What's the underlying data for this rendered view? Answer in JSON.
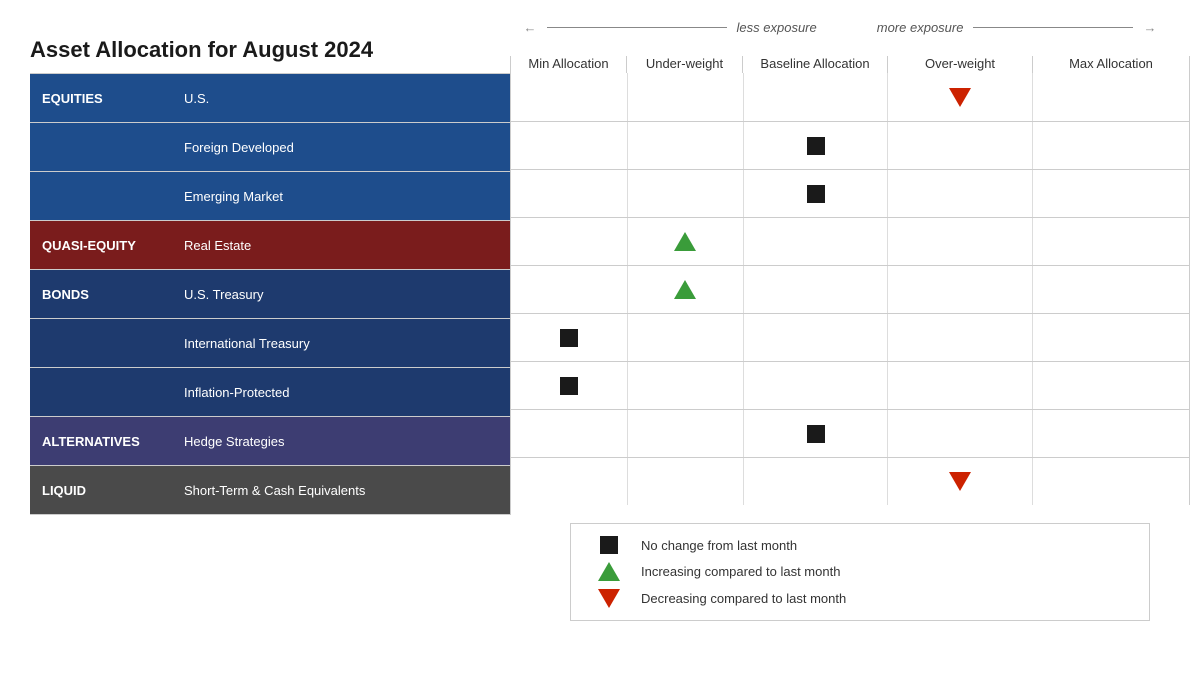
{
  "title": "Asset Allocation for August 2024",
  "exposure": {
    "less": "less exposure",
    "more": "more exposure"
  },
  "columns": {
    "min": "Min Allocation",
    "under": "Under-weight",
    "baseline": "Baseline Allocation",
    "over": "Over-weight",
    "max": "Max Allocation"
  },
  "rows": [
    {
      "category": "EQUITIES",
      "category_color": "equities-color",
      "sub_items": [
        {
          "label": "U.S.",
          "min": "",
          "under": "",
          "baseline": "",
          "over": "down",
          "max": ""
        },
        {
          "label": "Foreign Developed",
          "min": "",
          "under": "",
          "baseline": "square",
          "over": "",
          "max": ""
        },
        {
          "label": "Emerging Market",
          "min": "",
          "under": "",
          "baseline": "square",
          "over": "",
          "max": ""
        }
      ]
    },
    {
      "category": "QUASI-EQUITY",
      "category_color": "quasi-color",
      "sub_items": [
        {
          "label": "Real Estate",
          "min": "",
          "under": "up",
          "baseline": "",
          "over": "",
          "max": ""
        }
      ]
    },
    {
      "category": "BONDS",
      "category_color": "bonds-color",
      "sub_items": [
        {
          "label": "U.S. Treasury",
          "min": "",
          "under": "up",
          "baseline": "",
          "over": "",
          "max": ""
        },
        {
          "label": "International Treasury",
          "min": "square",
          "under": "",
          "baseline": "",
          "over": "",
          "max": ""
        },
        {
          "label": "Inflation-Protected",
          "min": "square",
          "under": "",
          "baseline": "",
          "over": "",
          "max": ""
        }
      ]
    },
    {
      "category": "ALTERNATIVES",
      "category_color": "alternatives-color",
      "sub_items": [
        {
          "label": "Hedge Strategies",
          "min": "",
          "under": "",
          "baseline": "square",
          "over": "",
          "max": ""
        }
      ]
    },
    {
      "category": "LIQUID",
      "category_color": "liquid-color",
      "sub_items": [
        {
          "label": "Short-Term & Cash Equivalents",
          "min": "",
          "under": "",
          "baseline": "",
          "over": "down",
          "max": ""
        }
      ]
    }
  ],
  "legend": [
    {
      "symbol": "square",
      "text": "No change from last month"
    },
    {
      "symbol": "up",
      "text": "Increasing compared to last month"
    },
    {
      "symbol": "down",
      "text": "Decreasing compared to last month"
    }
  ]
}
